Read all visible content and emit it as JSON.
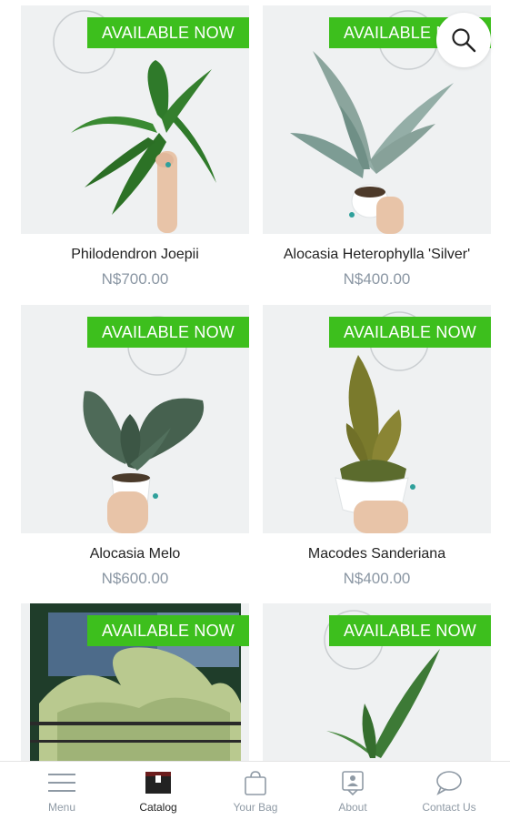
{
  "colors": {
    "badge": "#3dbf1d",
    "price": "#8a96a3",
    "tab_inactive": "#8f9aa5"
  },
  "products": [
    {
      "name": "Philodendron Joepii",
      "price": "N$700.00",
      "badge": "AVAILABLE NOW"
    },
    {
      "name": "Alocasia Heterophylla 'Silver'",
      "price": "N$400.00",
      "badge": "AVAILABLE NOW"
    },
    {
      "name": "Alocasia Melo",
      "price": "N$600.00",
      "badge": "AVAILABLE NOW"
    },
    {
      "name": "Macodes Sanderiana",
      "price": "N$400.00",
      "badge": "AVAILABLE NOW"
    },
    {
      "name": "",
      "price": "",
      "badge": "AVAILABLE NOW"
    },
    {
      "name": "",
      "price": "",
      "badge": "AVAILABLE NOW"
    }
  ],
  "search": {
    "icon": "search-icon"
  },
  "tabbar": {
    "items": [
      {
        "label": "Menu",
        "icon": "menu-icon",
        "active": false
      },
      {
        "label": "Catalog",
        "icon": "catalog-icon",
        "active": true
      },
      {
        "label": "Your Bag",
        "icon": "bag-icon",
        "active": false
      },
      {
        "label": "About",
        "icon": "about-icon",
        "active": false
      },
      {
        "label": "Contact Us",
        "icon": "chat-icon",
        "active": false
      }
    ]
  }
}
